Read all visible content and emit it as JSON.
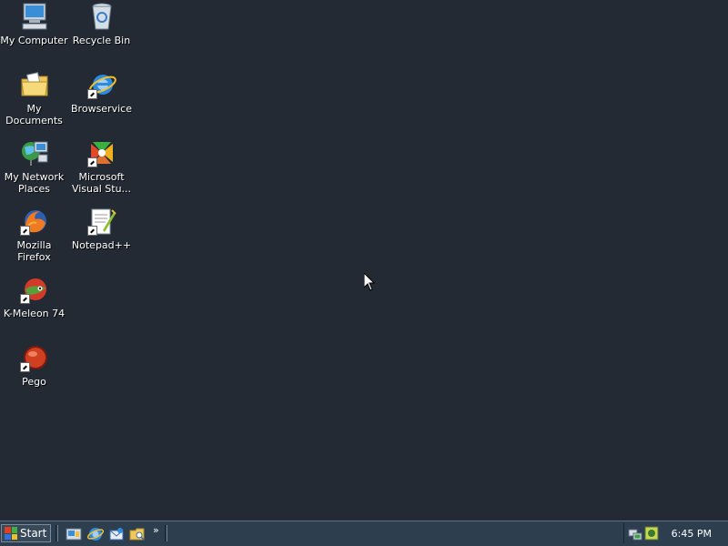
{
  "desktop": {
    "icons": [
      {
        "label": "My Computer"
      },
      {
        "label": "Recycle Bin"
      },
      {
        "label": "My Documents"
      },
      {
        "label": "Browservice"
      },
      {
        "label": "My Network Places"
      },
      {
        "label": "Microsoft Visual Stu..."
      },
      {
        "label": "Mozilla Firefox"
      },
      {
        "label": "Notepad++"
      },
      {
        "label": "K-Meleon 74"
      },
      {
        "label": "Pego"
      }
    ]
  },
  "taskbar": {
    "start_label": "Start",
    "overflow_chevron": "»",
    "clock": "6:45 PM"
  },
  "colors": {
    "desktop_bg": "#232a33",
    "taskbar_bg": "#2d3e4f"
  }
}
